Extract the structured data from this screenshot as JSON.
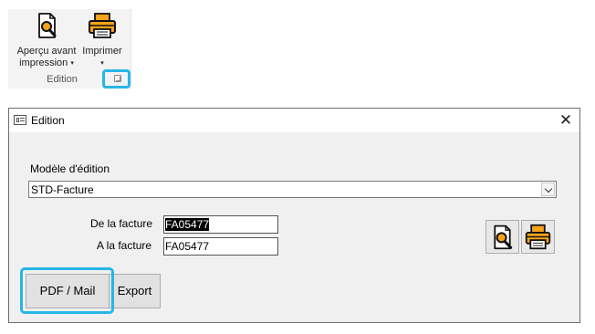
{
  "ribbon": {
    "apercu_line1": "Aperçu avant",
    "apercu_line2": "impression",
    "imprimer_label": "Imprimer",
    "group_label": "Edition",
    "caret": "▾"
  },
  "dialog": {
    "title": "Edition",
    "close_glyph": "✕",
    "model_label": "Modèle d'édition",
    "model_value": "STD-Facture",
    "from_label": "De la facture",
    "from_value": "FA05477",
    "to_label": "A la facture",
    "to_value": "FA05477",
    "pdf_mail_label": "PDF / Mail",
    "export_label": "Export"
  },
  "icons": {
    "preview": "preview-magnifier-icon",
    "printer": "printer-icon",
    "dialog_launcher": "dialog-launcher-icon",
    "app": "form-window-icon"
  },
  "colors": {
    "highlight": "#26b6e8",
    "icon_orange": "#f7a21b",
    "dialog_bg": "#f0f0f0"
  }
}
